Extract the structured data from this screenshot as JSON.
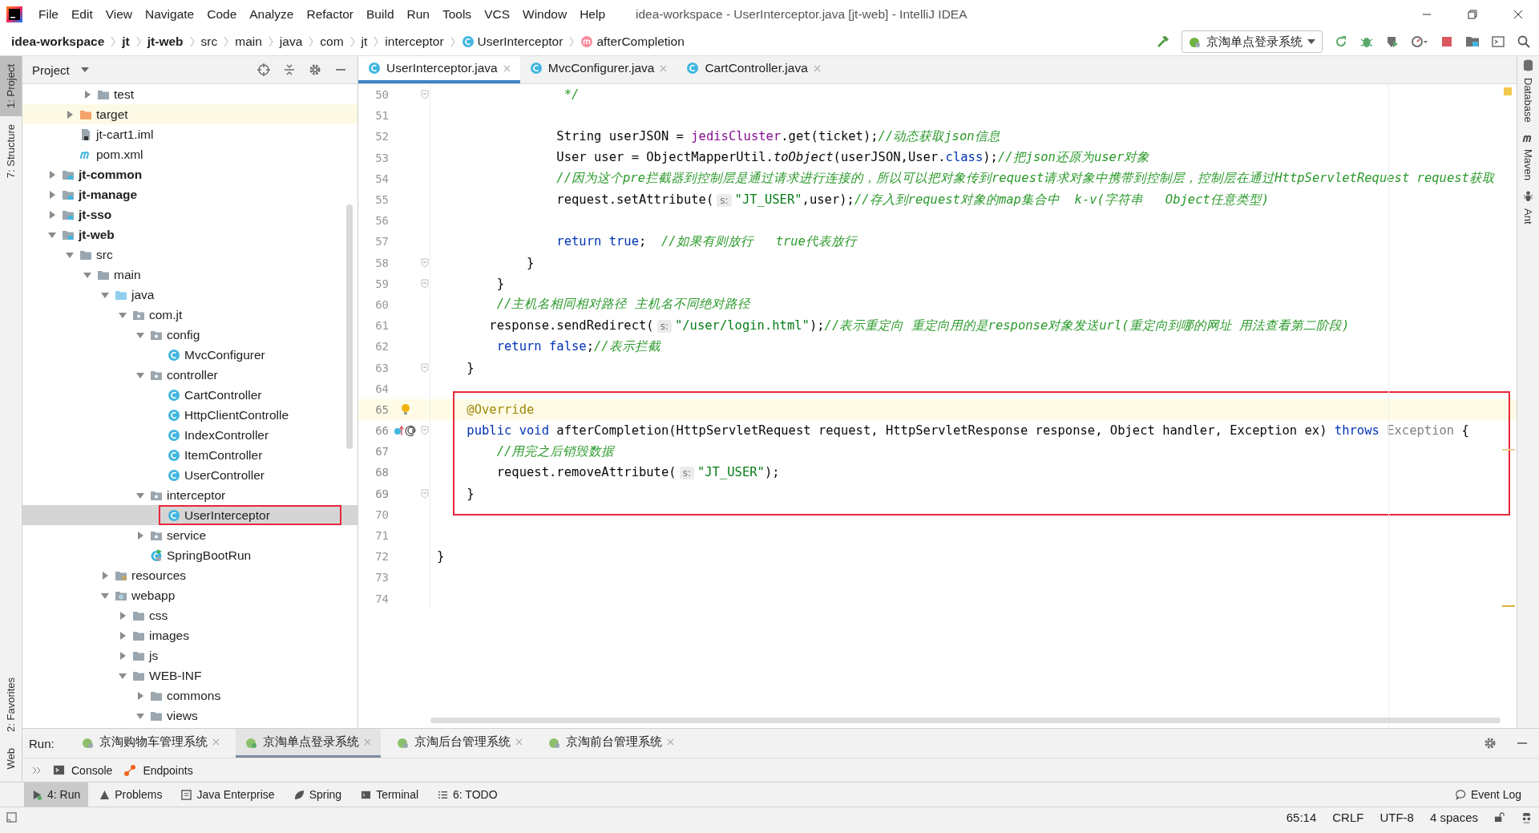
{
  "window": {
    "title": "idea-workspace - UserInterceptor.java [jt-web] - IntelliJ IDEA"
  },
  "menu": [
    "File",
    "Edit",
    "View",
    "Navigate",
    "Code",
    "Analyze",
    "Refactor",
    "Build",
    "Run",
    "Tools",
    "VCS",
    "Window",
    "Help"
  ],
  "breadcrumbs": [
    {
      "label": "idea-workspace",
      "kind": "module"
    },
    {
      "label": "jt",
      "kind": "module"
    },
    {
      "label": "jt-web",
      "kind": "module"
    },
    {
      "label": "src",
      "kind": "folder"
    },
    {
      "label": "main",
      "kind": "folder"
    },
    {
      "label": "java",
      "kind": "folder"
    },
    {
      "label": "com",
      "kind": "folder"
    },
    {
      "label": "jt",
      "kind": "folder"
    },
    {
      "label": "interceptor",
      "kind": "folder"
    },
    {
      "label": "UserInterceptor",
      "kind": "class"
    },
    {
      "label": "afterCompletion",
      "kind": "method"
    }
  ],
  "toolbar": {
    "run_config": "京淘单点登录系统"
  },
  "left_stripe": {
    "top": [
      {
        "label": "1: Project",
        "selected": true
      },
      {
        "label": "7: Structure",
        "selected": false
      }
    ],
    "bottom": [
      {
        "label": "2: Favorites",
        "selected": false
      },
      {
        "label": "Web",
        "selected": false
      }
    ]
  },
  "right_stripe": [
    "Database",
    "Maven",
    "Ant"
  ],
  "project_panel": {
    "title": "Project",
    "tree": [
      {
        "children": [
          {
            "children": [
              {
                "label": "test",
                "kind": "folder",
                "expanded": false,
                "selected": false
              }
            ]
          },
          {
            "label": "target",
            "kind": "excluded-folder",
            "expanded": false,
            "selected": false
          },
          {
            "label": "jt-cart1.iml",
            "kind": "iml-file",
            "selected": false
          },
          {
            "label": "pom.xml",
            "kind": "maven-file",
            "selected": false
          }
        ]
      },
      {
        "label": "jt-common",
        "kind": "module",
        "expanded": false,
        "selected": false
      },
      {
        "label": "jt-manage",
        "kind": "module",
        "expanded": false,
        "selected": false
      },
      {
        "label": "jt-sso",
        "kind": "module",
        "expanded": false,
        "selected": false
      },
      {
        "label": "jt-web",
        "kind": "module",
        "expanded": true,
        "selected": false,
        "children": [
          {
            "label": "src",
            "kind": "folder",
            "expanded": true,
            "selected": false,
            "children": [
              {
                "label": "main",
                "kind": "folder",
                "expanded": true,
                "selected": false,
                "children": [
                  {
                    "label": "java",
                    "kind": "source-folder",
                    "expanded": true,
                    "selected": false,
                    "children": [
                      {
                        "label": "com.jt",
                        "kind": "package",
                        "expanded": true,
                        "selected": false,
                        "children": [
                          {
                            "label": "config",
                            "kind": "package",
                            "expanded": true,
                            "selected": false,
                            "children": [
                              {
                                "label": "MvcConfigurer",
                                "kind": "class",
                                "selected": false
                              }
                            ]
                          },
                          {
                            "label": "controller",
                            "kind": "package",
                            "expanded": true,
                            "selected": false,
                            "children": [
                              {
                                "label": "CartController",
                                "kind": "class",
                                "selected": false
                              },
                              {
                                "label": "HttpClientControlle",
                                "kind": "class",
                                "selected": false
                              },
                              {
                                "label": "IndexController",
                                "kind": "class",
                                "selected": false
                              },
                              {
                                "label": "ItemController",
                                "kind": "class",
                                "selected": false
                              },
                              {
                                "label": "UserController",
                                "kind": "class",
                                "selected": false
                              }
                            ]
                          },
                          {
                            "label": "interceptor",
                            "kind": "package",
                            "expanded": true,
                            "selected": false,
                            "children": [
                              {
                                "label": "UserInterceptor",
                                "kind": "class",
                                "selected": true,
                                "highlighted": true
                              }
                            ]
                          },
                          {
                            "label": "service",
                            "kind": "package",
                            "expanded": false,
                            "selected": false
                          },
                          {
                            "label": "SpringBootRun",
                            "kind": "boot-class",
                            "selected": false
                          }
                        ]
                      }
                    ]
                  },
                  {
                    "label": "resources",
                    "kind": "resources-folder",
                    "expanded": false,
                    "selected": false
                  },
                  {
                    "label": "webapp",
                    "kind": "web-folder",
                    "expanded": true,
                    "selected": false,
                    "children": [
                      {
                        "label": "css",
                        "kind": "folder",
                        "expanded": false,
                        "selected": false
                      },
                      {
                        "label": "images",
                        "kind": "folder",
                        "expanded": false,
                        "selected": false
                      },
                      {
                        "label": "js",
                        "kind": "folder",
                        "expanded": false,
                        "selected": false
                      },
                      {
                        "label": "WEB-INF",
                        "kind": "folder",
                        "expanded": true,
                        "selected": false,
                        "children": [
                          {
                            "label": "commons",
                            "kind": "folder",
                            "expanded": false,
                            "selected": false
                          },
                          {
                            "label": "views",
                            "kind": "folder",
                            "expanded": true,
                            "selected": false
                          }
                        ]
                      }
                    ]
                  }
                ]
              }
            ]
          }
        ]
      }
    ]
  },
  "editor_tabs": [
    {
      "label": "UserInterceptor.java",
      "selected": true
    },
    {
      "label": "MvcConfigurer.java",
      "selected": false
    },
    {
      "label": "CartController.java",
      "selected": false
    }
  ],
  "code_lines": [
    {
      "number": "50",
      "fold": true,
      "current": false,
      "boxed": false,
      "segments": [
        {
          "kind": "comment",
          "text": "                 */"
        }
      ]
    },
    {
      "number": "51",
      "fold": false,
      "current": false,
      "boxed": false
    },
    {
      "number": "52",
      "fold": false,
      "current": false,
      "boxed": false,
      "segments": [
        {
          "kind": "plain",
          "text": "                String userJSON = "
        },
        {
          "kind": "field",
          "text": "jedisCluster"
        },
        {
          "kind": "plain",
          "text": ".get(ticket);"
        },
        {
          "kind": "comment",
          "text": "//动态获取json信息"
        }
      ]
    },
    {
      "number": "53",
      "fold": false,
      "current": false,
      "boxed": false,
      "segments": [
        {
          "kind": "plain",
          "text": "                User user = ObjectMapperUtil."
        },
        {
          "kind": "static",
          "text": "toObject"
        },
        {
          "kind": "plain",
          "text": "(userJSON,User."
        },
        {
          "kind": "keyword",
          "text": "class"
        },
        {
          "kind": "plain",
          "text": ");"
        },
        {
          "kind": "comment",
          "text": "//把json还原为user对象"
        }
      ]
    },
    {
      "number": "54",
      "fold": false,
      "current": false,
      "boxed": false,
      "segments": [
        {
          "kind": "comment",
          "text": "                //因为这个pre拦截器到控制层是通过请求进行连接的，所以可以把对象传到request请求对象中携带到控制层，控制层在通过HttpServletRequest request获取"
        }
      ]
    },
    {
      "number": "55",
      "fold": false,
      "current": false,
      "boxed": false,
      "segments": [
        {
          "kind": "plain",
          "text": "                request.setAttribute("
        },
        {
          "kind": "hint",
          "text": "s:"
        },
        {
          "kind": "string",
          "text": "\"JT_USER\""
        },
        {
          "kind": "plain",
          "text": ",user);"
        },
        {
          "kind": "comment",
          "text": "//存入到request对象的map集合中  k-v(字符串   Object任意类型)"
        }
      ]
    },
    {
      "number": "56",
      "fold": false,
      "current": false,
      "boxed": false
    },
    {
      "number": "57",
      "fold": false,
      "current": false,
      "boxed": false,
      "segments": [
        {
          "kind": "keyword",
          "text": "                return true"
        },
        {
          "kind": "plain",
          "text": ";  "
        },
        {
          "kind": "comment",
          "text": "//如果有则放行   true代表放行"
        }
      ]
    },
    {
      "number": "58",
      "fold": true,
      "current": false,
      "boxed": false,
      "segments": [
        {
          "kind": "plain",
          "text": "            }"
        }
      ]
    },
    {
      "number": "59",
      "fold": true,
      "current": false,
      "boxed": false,
      "segments": [
        {
          "kind": "plain",
          "text": "        }"
        }
      ]
    },
    {
      "number": "60",
      "fold": false,
      "current": false,
      "boxed": false,
      "segments": [
        {
          "kind": "comment",
          "text": "        //主机名相同相对路径 主机名不同绝对路径"
        }
      ]
    },
    {
      "number": "61",
      "fold": false,
      "current": false,
      "boxed": false,
      "segments": [
        {
          "kind": "plain",
          "text": "       response.sendRedirect("
        },
        {
          "kind": "hint",
          "text": "s:"
        },
        {
          "kind": "string",
          "text": "\"/user/login.html\""
        },
        {
          "kind": "plain",
          "text": ");"
        },
        {
          "kind": "comment",
          "text": "//表示重定向 重定向用的是response对象发送url(重定向到哪的网址 用法查看第二阶段)"
        }
      ]
    },
    {
      "number": "62",
      "fold": false,
      "current": false,
      "boxed": false,
      "segments": [
        {
          "kind": "keyword",
          "text": "        return false"
        },
        {
          "kind": "plain",
          "text": ";"
        },
        {
          "kind": "comment",
          "text": "//表示拦截"
        }
      ]
    },
    {
      "number": "63",
      "fold": true,
      "current": false,
      "boxed": false,
      "segments": [
        {
          "kind": "plain",
          "text": "    }"
        }
      ]
    },
    {
      "number": "64",
      "fold": false,
      "current": false,
      "boxed": false
    },
    {
      "number": "65",
      "fold": false,
      "current": true,
      "boxed": true,
      "kind": "bulb",
      "segments": [
        {
          "kind": "annotation",
          "text": "    @Override"
        }
      ]
    },
    {
      "number": "66",
      "fold": true,
      "current": false,
      "boxed": true,
      "kind": "override",
      "segments": [
        {
          "kind": "keyword",
          "text": "    public void "
        },
        {
          "kind": "plain",
          "text": "afterCompletion(HttpServletRequest request, HttpServletResponse response, Object handler, Exception ex) "
        },
        {
          "kind": "keyword",
          "text": "throws"
        },
        {
          "kind": "muted",
          "text": " Exception"
        },
        {
          "kind": "plain",
          "text": " {"
        }
      ]
    },
    {
      "number": "67",
      "fold": false,
      "current": false,
      "boxed": true,
      "segments": [
        {
          "kind": "comment",
          "text": "        //用完之后销毁数据"
        }
      ]
    },
    {
      "number": "68",
      "fold": false,
      "current": false,
      "boxed": true,
      "segments": [
        {
          "kind": "plain",
          "text": "        request.removeAttribute("
        },
        {
          "kind": "hint",
          "text": "s:"
        },
        {
          "kind": "string",
          "text": "\"JT_USER\""
        },
        {
          "kind": "plain",
          "text": ");"
        }
      ]
    },
    {
      "number": "69",
      "fold": true,
      "current": false,
      "boxed": true,
      "segments": [
        {
          "kind": "plain",
          "text": "    }"
        }
      ]
    },
    {
      "number": "70",
      "fold": false,
      "current": false,
      "boxed": false
    },
    {
      "number": "71",
      "fold": false,
      "current": false,
      "boxed": false
    },
    {
      "number": "72",
      "fold": false,
      "current": false,
      "boxed": false,
      "segments": [
        {
          "kind": "plain",
          "text": "}"
        }
      ]
    },
    {
      "number": "73",
      "fold": false,
      "current": false,
      "boxed": false
    },
    {
      "number": "74",
      "fold": false,
      "current": false,
      "boxed": false
    }
  ],
  "run_panel": {
    "label": "Run:",
    "tabs": [
      {
        "label": "京淘购物车管理系统",
        "selected": false
      },
      {
        "label": "京淘单点登录系统",
        "selected": true
      },
      {
        "label": "京淘后台管理系统",
        "selected": false
      },
      {
        "label": "京淘前台管理系统",
        "selected": false
      }
    ],
    "subtabs": [
      "Console",
      "Endpoints"
    ]
  },
  "tool_buttons": [
    {
      "label": "4: Run",
      "kind": "run",
      "selected": true
    },
    {
      "label": "Problems",
      "kind": "problems",
      "selected": false
    },
    {
      "label": "Java Enterprise",
      "kind": "enterprise",
      "selected": false
    },
    {
      "label": "Spring",
      "kind": "spring",
      "selected": false
    },
    {
      "label": "Terminal",
      "kind": "terminal",
      "selected": false
    },
    {
      "label": "6: TODO",
      "kind": "todo",
      "selected": false
    }
  ],
  "event_log": "Event Log",
  "status_bar": [
    "65:14",
    "CRLF",
    "UTF-8",
    "4 spaces"
  ]
}
